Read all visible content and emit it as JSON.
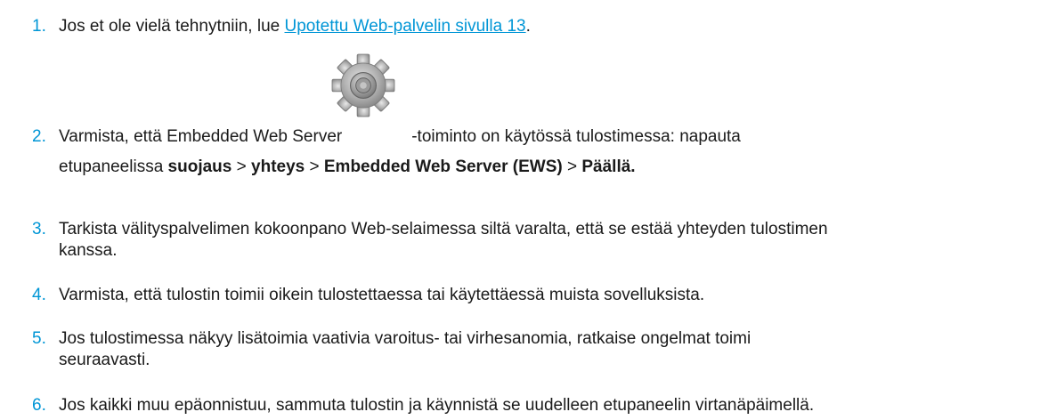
{
  "steps": [
    {
      "number": "1.",
      "before": "Jos et ole vielä tehnytniin, lue ",
      "link": "Upotettu Web-palvelin sivulla 13",
      "after": "."
    },
    {
      "number": "2.",
      "line1_a": "Varmista, että Embedded Web Server",
      "line1_b": "-toiminto on käytössä tulostimessa: napauta",
      "line2_a": "etupaneelissa ",
      "m1": "suojaus",
      "sep1": " > ",
      "m2": "yhteys",
      "sep2": " > ",
      "m3": "Embedded Web Server (EWS)",
      "sep3": " > ",
      "m4": "Päällä."
    },
    {
      "number": "3.",
      "line1": "Tarkista välityspalvelimen kokoonpano Web-selaimessa siltä varalta, että se estää yhteyden tulostimen",
      "line2": "kanssa."
    },
    {
      "number": "4.",
      "text": "Varmista, että tulostin toimii oikein tulostettaessa tai käytettäessä muista sovelluksista."
    },
    {
      "number": "5.",
      "line1": "Jos tulostimessa näkyy lisätoimia vaativia varoitus- tai virhesanomia, ratkaise ongelmat toimi",
      "line2": "seuraavasti."
    },
    {
      "number": "6.",
      "text": "Jos kaikki muu epäonnistuu, sammuta tulostin ja käynnistä se uudelleen etupaneelin virtanäpäimellä."
    }
  ],
  "icons": {
    "settings": "gear-icon"
  },
  "colors": {
    "accent": "#0096d6",
    "text": "#1a1a1a"
  }
}
